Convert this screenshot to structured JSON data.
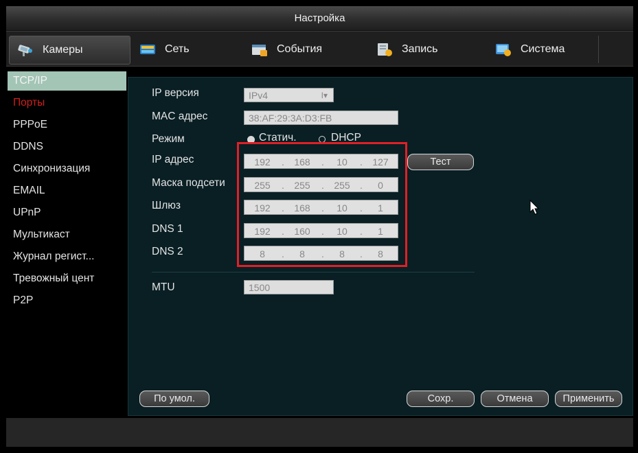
{
  "window": {
    "title": "Настройка"
  },
  "tabs": [
    {
      "label": "Камеры",
      "icon": "camera-icon",
      "active": true
    },
    {
      "label": "Сеть",
      "icon": "network-icon",
      "active": false
    },
    {
      "label": "События",
      "icon": "events-icon",
      "active": false
    },
    {
      "label": "Запись",
      "icon": "record-icon",
      "active": false
    },
    {
      "label": "Система",
      "icon": "system-icon",
      "active": false
    }
  ],
  "menu": [
    {
      "label": "TCP/IP",
      "state": "selected"
    },
    {
      "label": "Порты",
      "state": "red"
    },
    {
      "label": "PPPoE"
    },
    {
      "label": "DDNS"
    },
    {
      "label": "Синхронизация"
    },
    {
      "label": "EMAIL"
    },
    {
      "label": "UPnP"
    },
    {
      "label": "Мультикаст"
    },
    {
      "label": "Журнал регист..."
    },
    {
      "label": "Тревожный цент"
    },
    {
      "label": "P2P"
    }
  ],
  "form": {
    "ip_version": {
      "label": "IP версия",
      "value": "IPv4",
      "dropdown_glyph": "I▾"
    },
    "mac": {
      "label": "MAC адрес",
      "value": "38:AF:29:3A:D3:FB"
    },
    "mode": {
      "label": "Режим",
      "static_label": "Статич.",
      "dhcp_label": "DHCP",
      "selected": "static"
    },
    "ip": {
      "label": "IP адрес",
      "octets": [
        "192",
        "168",
        "10",
        "127"
      ]
    },
    "mask": {
      "label": "Маска подсети",
      "octets": [
        "255",
        "255",
        "255",
        "0"
      ]
    },
    "gateway": {
      "label": "Шлюз",
      "octets": [
        "192",
        "168",
        "10",
        "1"
      ]
    },
    "dns1": {
      "label": "DNS 1",
      "octets": [
        "192",
        "160",
        "10",
        "1"
      ]
    },
    "dns2": {
      "label": "DNS 2",
      "octets": [
        "8",
        "8",
        "8",
        "8"
      ]
    },
    "mtu": {
      "label": "MTU",
      "value": "1500"
    },
    "octet_separator": "."
  },
  "buttons": {
    "test": "Тест",
    "default": "По умол.",
    "save": "Сохр.",
    "cancel": "Отмена",
    "apply": "Применить"
  },
  "colors": {
    "highlight_box": "#e01f26",
    "menu_selected_bg": "#a3c5b6",
    "menu_red_text": "#d21d1d",
    "panel_bg": "#091f24"
  }
}
